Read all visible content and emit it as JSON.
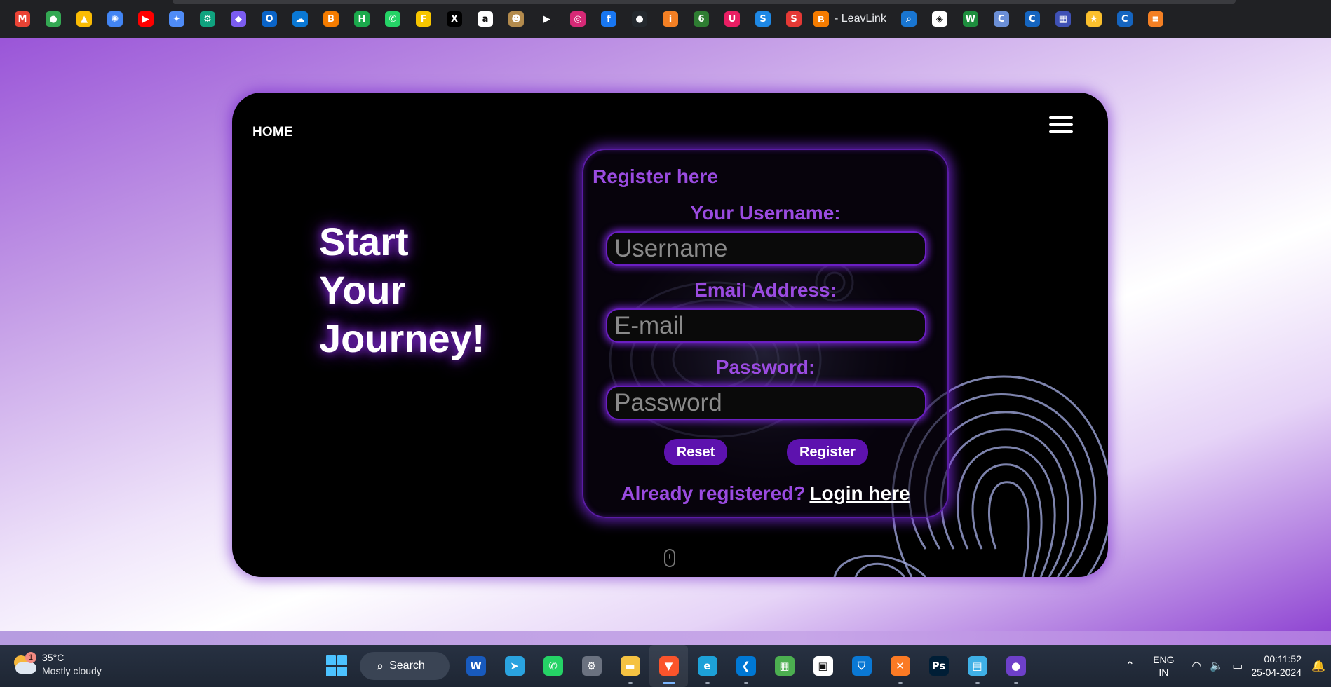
{
  "bookmarks": [
    {
      "name": "gmail-icon",
      "glyph": "M",
      "color": "#ea4335"
    },
    {
      "name": "maps-icon",
      "glyph": "●",
      "color": "#34a853"
    },
    {
      "name": "drive-icon",
      "glyph": "▲",
      "color": "#fbbc04"
    },
    {
      "name": "photos-icon",
      "glyph": "✺",
      "color": "#4285f4"
    },
    {
      "name": "youtube-icon",
      "glyph": "▶",
      "color": "#ff0000"
    },
    {
      "name": "gemini-icon",
      "glyph": "✦",
      "color": "#4f8cf7"
    },
    {
      "name": "chatgpt-icon",
      "glyph": "⚙",
      "color": "#10a37f"
    },
    {
      "name": "copilot-icon",
      "glyph": "◆",
      "color": "#7b5cf0"
    },
    {
      "name": "outlook-icon",
      "glyph": "O",
      "color": "#0a64c8"
    },
    {
      "name": "onedrive-icon",
      "glyph": "☁",
      "color": "#0a78d4"
    },
    {
      "name": "blogger-icon",
      "glyph": "B",
      "color": "#f57c00"
    },
    {
      "name": "hackerrank-icon",
      "glyph": "H",
      "color": "#1ba94c"
    },
    {
      "name": "whatsapp-icon",
      "glyph": "✆",
      "color": "#25d366"
    },
    {
      "name": "flipkart-icon",
      "glyph": "F",
      "color": "#f7c600"
    },
    {
      "name": "x-icon",
      "glyph": "X",
      "color": "#000000"
    },
    {
      "name": "amazon-icon",
      "glyph": "a",
      "color": "#ffffff"
    },
    {
      "name": "mask-icon",
      "glyph": "☻",
      "color": "#b38b4d"
    },
    {
      "name": "play-icon",
      "glyph": "▶",
      "color": "#202124"
    },
    {
      "name": "instagram-icon",
      "glyph": "◎",
      "color": "#d62976"
    },
    {
      "name": "facebook-icon",
      "glyph": "f",
      "color": "#1877f2"
    },
    {
      "name": "github-icon",
      "glyph": "●",
      "color": "#24292e"
    },
    {
      "name": "info-icon",
      "glyph": "i",
      "color": "#f48024"
    },
    {
      "name": "leaf-icon",
      "glyph": "6",
      "color": "#2e7d32"
    },
    {
      "name": "bookmark-app-icon",
      "glyph": "U",
      "color": "#e91e63"
    },
    {
      "name": "s-blue-icon",
      "glyph": "S",
      "color": "#1e88e5"
    },
    {
      "name": "s-red-icon",
      "glyph": "S",
      "color": "#e53935"
    }
  ],
  "bookmark_folder": {
    "icon": "B",
    "label": "- LeavLink"
  },
  "bookmarks_right": [
    {
      "name": "search-bookmark-icon",
      "glyph": "⌕",
      "color": "#1976d2"
    },
    {
      "name": "codepen-icon",
      "glyph": "◈",
      "color": "#ffffff"
    },
    {
      "name": "w-icon",
      "glyph": "W",
      "color": "#1e8e3e"
    },
    {
      "name": "cbt-icon",
      "glyph": "C",
      "color": "#6b8fd6"
    },
    {
      "name": "c-blue-icon",
      "glyph": "C",
      "color": "#1565c0"
    },
    {
      "name": "layout-icon",
      "glyph": "▦",
      "color": "#3f51b5"
    },
    {
      "name": "star-icon",
      "glyph": "★",
      "color": "#fbc02d"
    },
    {
      "name": "c-blue2-icon",
      "glyph": "C",
      "color": "#1565c0"
    },
    {
      "name": "stack-icon",
      "glyph": "≡",
      "color": "#f48024"
    }
  ],
  "nav": {
    "home_label": "HOME"
  },
  "hero": {
    "line1": "Start",
    "line2": "Your",
    "line3": "Journey!"
  },
  "form": {
    "title": "Register here",
    "username_label": "Your Username:",
    "username_placeholder": "Username",
    "email_label": "Email Address:",
    "email_placeholder": "E-mail",
    "password_label": "Password:",
    "password_placeholder": "Password",
    "reset_label": "Reset",
    "register_label": "Register",
    "already_text": "Already registered?",
    "login_link": "Login here"
  },
  "taskbar": {
    "weather": {
      "badge": "1",
      "temp": "35°C",
      "condition": "Mostly cloudy"
    },
    "search_label": "Search",
    "apps": [
      {
        "name": "word-icon",
        "glyph": "W",
        "color": "#185abd"
      },
      {
        "name": "telegram-icon",
        "glyph": "➤",
        "color": "#2aa3df"
      },
      {
        "name": "whatsapp-taskbar-icon",
        "glyph": "✆",
        "color": "#25d366"
      },
      {
        "name": "settings-icon",
        "glyph": "⚙",
        "color": "#6b7280"
      },
      {
        "name": "file-explorer-icon",
        "glyph": "▬",
        "color": "#f5c242"
      },
      {
        "name": "brave-icon",
        "glyph": "▼",
        "color": "#fb542b"
      },
      {
        "name": "edge-icon",
        "glyph": "e",
        "color": "#1da1d8"
      },
      {
        "name": "vscode-icon",
        "glyph": "❮",
        "color": "#0078d4"
      },
      {
        "name": "app-grid-icon",
        "glyph": "▦",
        "color": "#4caf50"
      },
      {
        "name": "store-icon",
        "glyph": "▣",
        "color": "#ffffff"
      },
      {
        "name": "defender-icon",
        "glyph": "⛉",
        "color": "#0a78d4"
      },
      {
        "name": "xampp-icon",
        "glyph": "✕",
        "color": "#fb7a24"
      },
      {
        "name": "photoshop-icon",
        "glyph": "Ps",
        "color": "#001e36"
      },
      {
        "name": "notepad-icon",
        "glyph": "▤",
        "color": "#3fb0e6"
      },
      {
        "name": "github-desktop-icon",
        "glyph": "●",
        "color": "#6e40c9"
      }
    ],
    "lang_line1": "ENG",
    "lang_line2": "IN",
    "time": "00:11:52",
    "date": "25-04-2024"
  }
}
